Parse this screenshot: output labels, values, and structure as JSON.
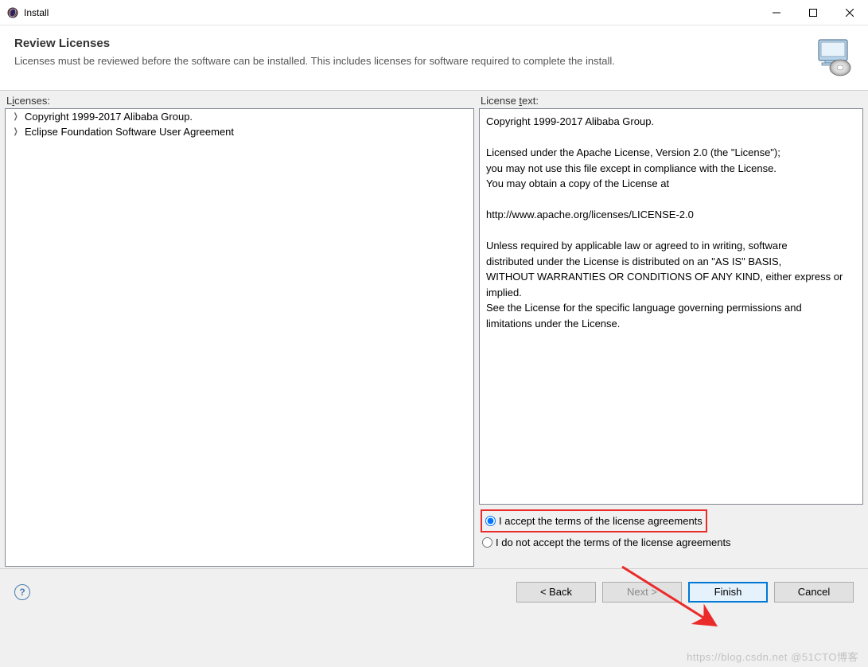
{
  "titlebar": {
    "title": "Install"
  },
  "header": {
    "title": "Review Licenses",
    "description": "Licenses must be reviewed before the software can be installed.  This includes licenses for software required to complete the install."
  },
  "panels": {
    "licenses_label_pre": "L",
    "licenses_label_ul": "i",
    "licenses_label_post": "censes:",
    "license_text_label_pre": "License ",
    "license_text_label_ul": "t",
    "license_text_label_post": "ext:"
  },
  "tree": {
    "items": [
      "Copyright 1999-2017 Alibaba Group.",
      "Eclipse Foundation Software User Agreement"
    ]
  },
  "license_text": "Copyright 1999-2017 Alibaba Group.\n\nLicensed under the Apache License, Version 2.0 (the \"License\");\nyou may not use this file except in compliance with the License.\nYou may obtain a copy of the License at\n\nhttp://www.apache.org/licenses/LICENSE-2.0\n\nUnless required by applicable law or agreed to in writing, software\ndistributed under the License is distributed on an \"AS IS\" BASIS,\nWITHOUT WARRANTIES OR CONDITIONS OF ANY KIND, either express or implied.\nSee the License for the specific language governing permissions and\nlimitations under the License.",
  "radios": {
    "accept": "I accept the terms of the license agreements",
    "decline": "I do not accept the terms of the license agreements",
    "selected": "accept"
  },
  "buttons": {
    "back": "< Back",
    "next": "Next >",
    "finish": "Finish",
    "cancel": "Cancel"
  },
  "watermark": "https://blog.csdn.net @51CTO博客"
}
